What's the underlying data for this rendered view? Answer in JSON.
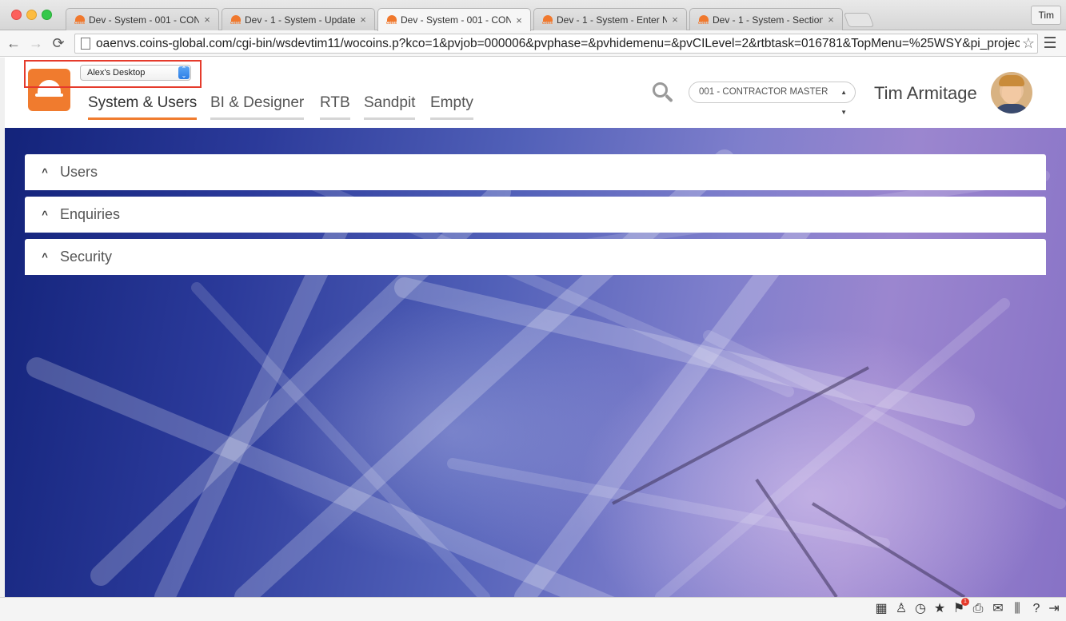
{
  "browser": {
    "tabs": [
      {
        "title": "Dev - System - 001 - CON",
        "active": false
      },
      {
        "title": "Dev - 1 - System - Update",
        "active": false
      },
      {
        "title": "Dev - System - 001 - CON",
        "active": true
      },
      {
        "title": "Dev - 1 - System - Enter N",
        "active": false
      },
      {
        "title": "Dev - 1 - System - Section",
        "active": false
      }
    ],
    "profile": "Tim",
    "url": "oaenvs.coins-global.com/cgi-bin/wsdevtim11/wocoins.p?kco=1&pvjob=000006&pvphase=&pvhidemenu=&pvCILevel=2&rtbtask=016781&TopMenu=%25WSY&pi_projectRow..."
  },
  "header": {
    "desktop_select": "Alex's Desktop",
    "menu_tabs": [
      {
        "label": "System & Users",
        "active": true
      },
      {
        "label": "BI & Designer",
        "active": false
      },
      {
        "label": "RTB",
        "active": false
      },
      {
        "label": "Sandpit",
        "active": false
      },
      {
        "label": "Empty",
        "active": false
      }
    ],
    "company_select": "001 - CONTRACTOR MASTER",
    "user_name": "Tim Armitage",
    "accent_color": "#f07b2e",
    "highlight_color": "#e53b2c"
  },
  "panels": [
    {
      "label": "Users",
      "icon": "chevron-up-icon"
    },
    {
      "label": "Enquiries",
      "icon": "chevron-up-icon"
    },
    {
      "label": "Security",
      "icon": "chevron-up-icon"
    }
  ],
  "statusbar": {
    "icons": [
      "grid-icon",
      "person-icon",
      "history-icon",
      "star-icon",
      "flag-icon",
      "printer-icon",
      "mail-icon",
      "library-icon",
      "help-icon",
      "logout-icon"
    ],
    "notification_count": "1"
  }
}
